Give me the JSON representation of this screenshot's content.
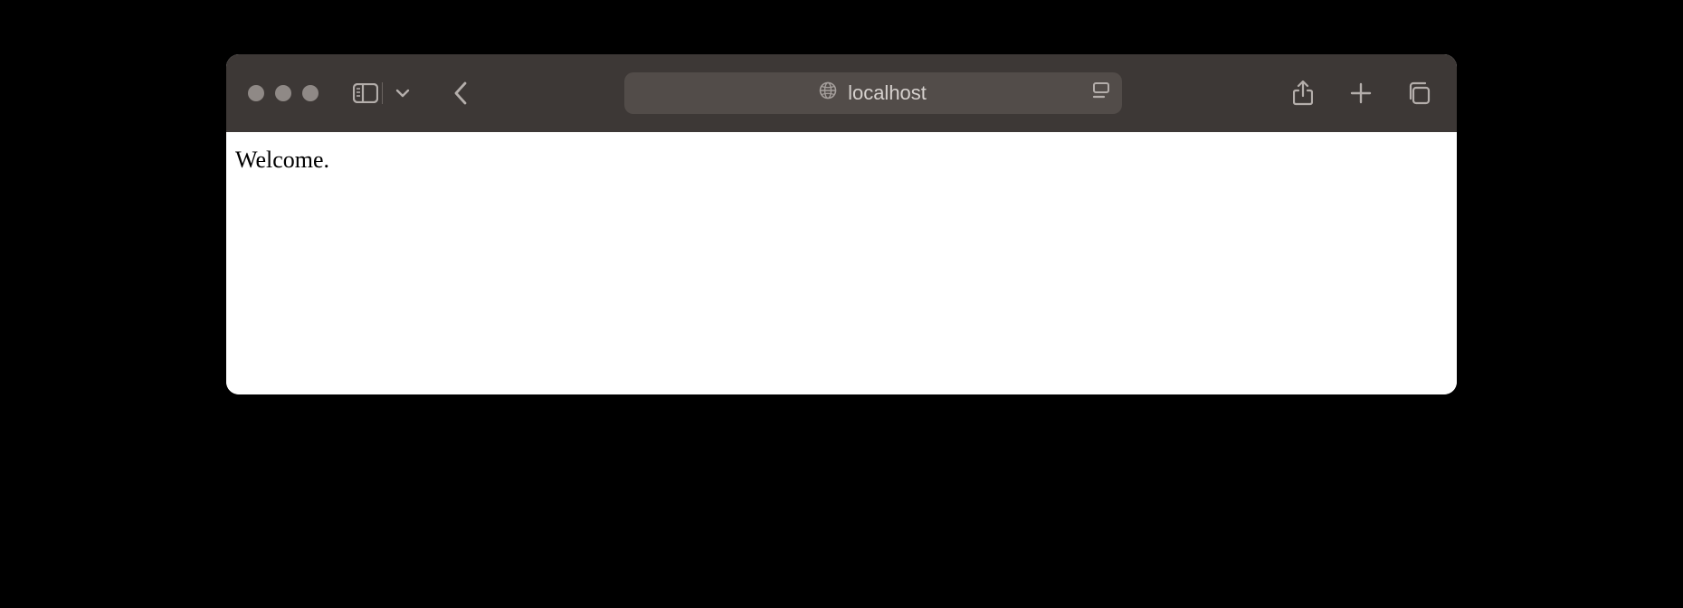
{
  "addressbar": {
    "host": "localhost"
  },
  "page": {
    "body_text": "Welcome."
  }
}
